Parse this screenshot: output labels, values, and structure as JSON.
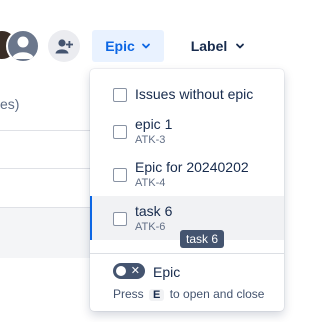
{
  "toolbar": {
    "epic_label": "Epic",
    "label_label": "Label"
  },
  "background": {
    "partial_text": "es)"
  },
  "dropdown": {
    "items": [
      {
        "title": "Issues without epic",
        "key": ""
      },
      {
        "title": "epic 1",
        "key": "ATK-3"
      },
      {
        "title": "Epic for 20240202",
        "key": "ATK-4"
      },
      {
        "title": "task 6",
        "key": "ATK-6"
      }
    ],
    "tooltip": "task 6",
    "toggle_label": "Epic",
    "hint_pre": "Press",
    "hint_key": "E",
    "hint_post": "to open and close"
  },
  "colors": {
    "accent": "#0c66e4",
    "accent_bg": "#e9f2ff"
  }
}
